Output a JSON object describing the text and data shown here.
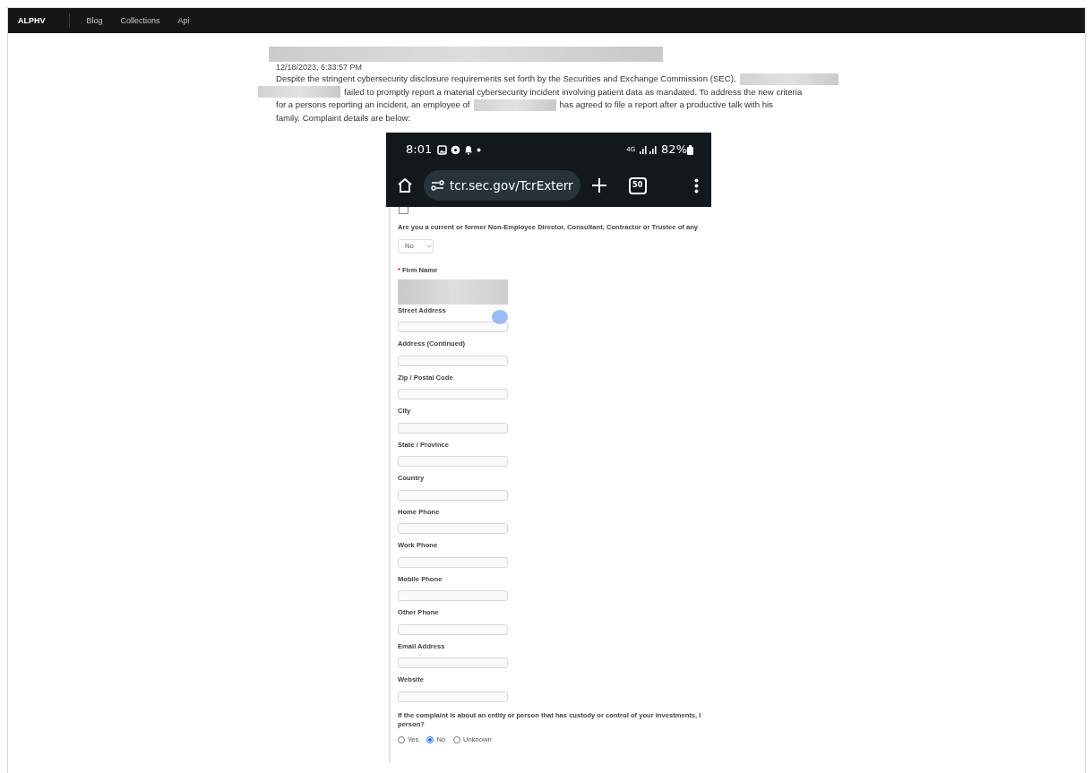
{
  "nav": {
    "brand": "ALPHV",
    "links": [
      "Blog",
      "Collections",
      "Api"
    ]
  },
  "post": {
    "timestamp": "12/18/2023, 6:33:57 PM",
    "lines": [
      [
        {
          "kind": "text",
          "text": "Despite the stringent cybersecurity disclosure requirements set forth by the Securities and Exchange Commission (SEC),"
        },
        {
          "kind": "redacted"
        }
      ],
      [
        {
          "kind": "redacted"
        },
        {
          "kind": "text",
          "text": "failed to promptly report a material cybersecurity incident involving patient data as mandated. To address the new criteria"
        }
      ],
      [
        {
          "kind": "text",
          "text": "for a persons reporting an incident, an employee of"
        },
        {
          "kind": "redacted"
        },
        {
          "kind": "text",
          "text": "has agreed to file a report after a productive talk with his"
        }
      ],
      [
        {
          "kind": "text",
          "text": "family. Complaint details are below:"
        }
      ]
    ]
  },
  "phone": {
    "time": "8:01",
    "network": "4G",
    "battery": "82%",
    "url": "tcr.sec.gov/TcrExterr",
    "tab_count": "50"
  },
  "form": {
    "checkbox": {
      "checked": false
    },
    "question": "Are you a current or former Non-Employee Director, Consultant, Contractor or Trustee of any",
    "select_value": "No",
    "required_mark": "*",
    "firm_label": "Firm Name",
    "fields": [
      "Street Address",
      "Address (Continued)",
      "Zip / Postal Code",
      "City",
      "State / Province",
      "Country",
      "Home Phone",
      "Work Phone",
      "Mobile Phone",
      "Other Phone",
      "Email Address",
      "Website"
    ],
    "custody_question": [
      "If the complaint is about an entity or person that has custody or control of your investments, I",
      "person?"
    ],
    "options": [
      {
        "label": "Yes",
        "selected": false
      },
      {
        "label": "No",
        "selected": true
      },
      {
        "label": "Unknown",
        "selected": false
      }
    ]
  }
}
